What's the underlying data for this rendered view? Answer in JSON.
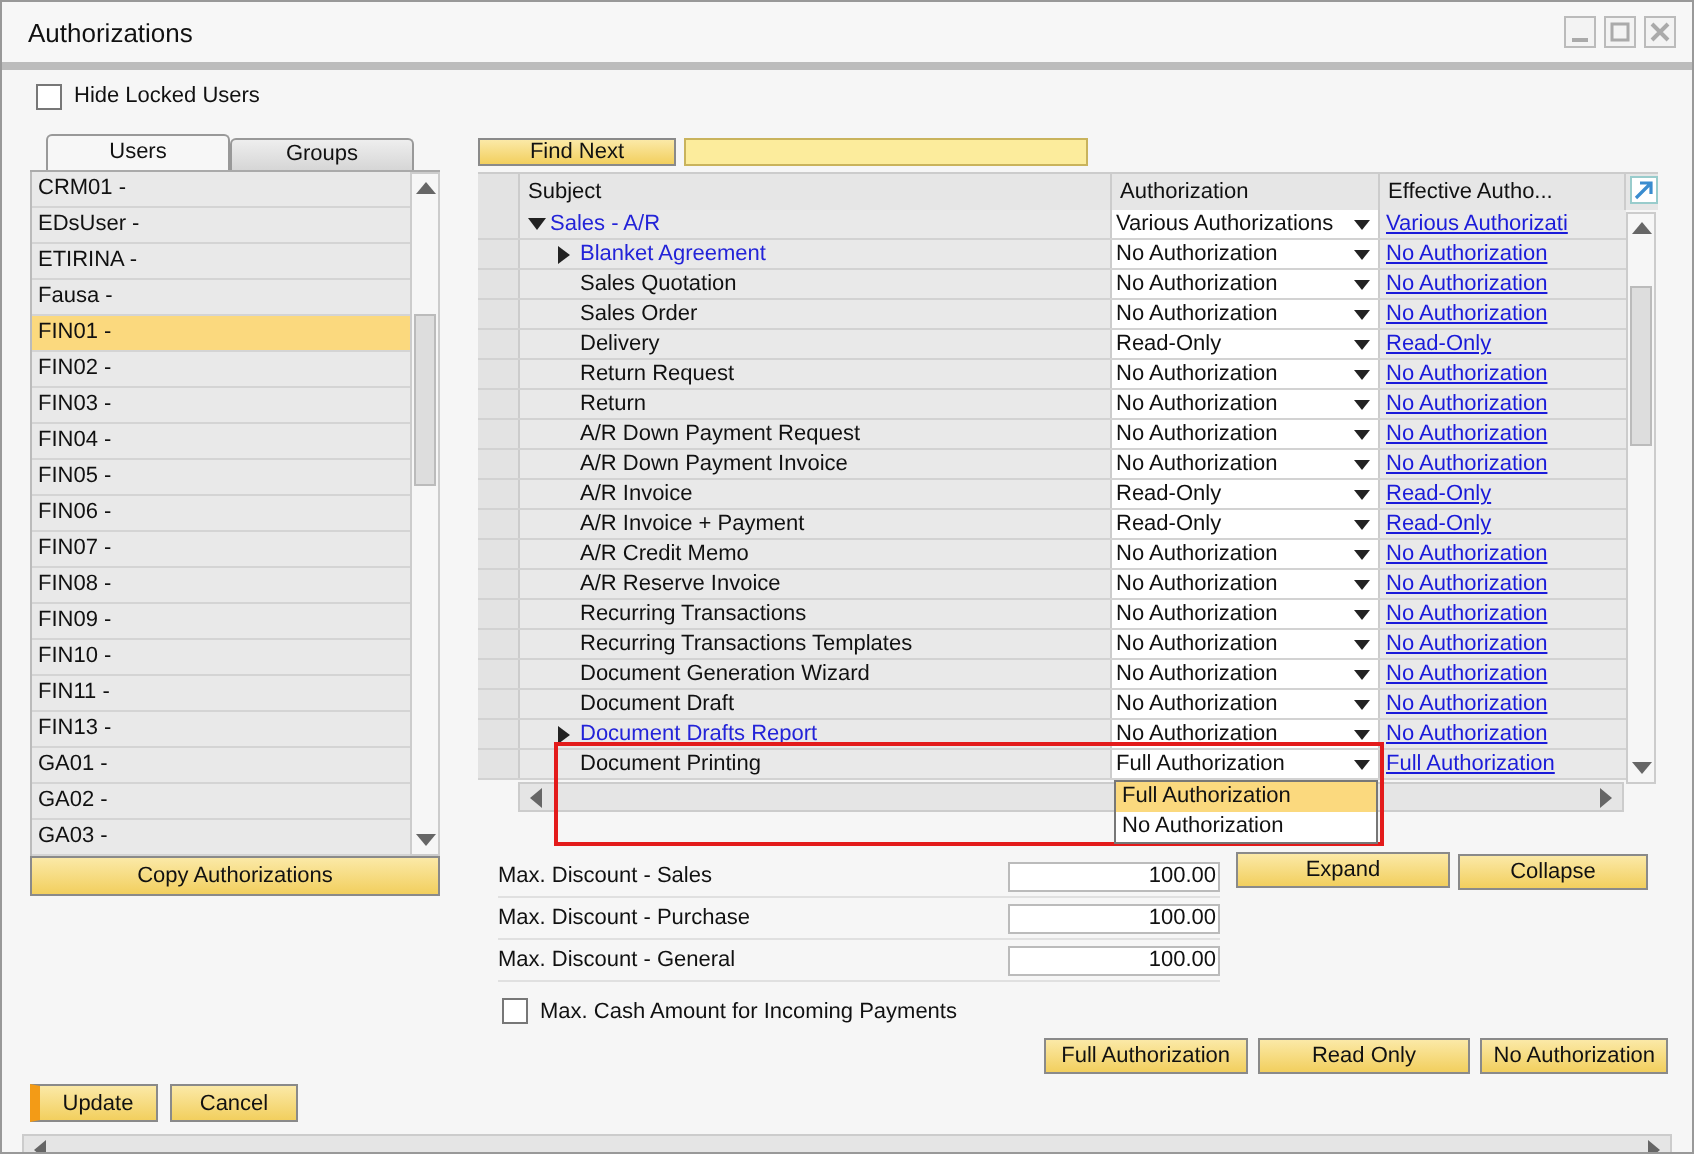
{
  "window": {
    "title": "Authorizations"
  },
  "hide_locked_users": {
    "label": "Hide Locked Users",
    "checked": false
  },
  "user_tabs": [
    {
      "label": "Users",
      "selected": true
    },
    {
      "label": "Groups",
      "selected": false
    }
  ],
  "users": [
    {
      "name": "CRM01 -",
      "selected": false
    },
    {
      "name": "EDsUser -",
      "selected": false
    },
    {
      "name": "ETIRINA -",
      "selected": false
    },
    {
      "name": "Fausa -",
      "selected": false
    },
    {
      "name": "FIN01 -",
      "selected": true
    },
    {
      "name": "FIN02 -",
      "selected": false
    },
    {
      "name": "FIN03 -",
      "selected": false
    },
    {
      "name": "FIN04 -",
      "selected": false
    },
    {
      "name": "FIN05 -",
      "selected": false
    },
    {
      "name": "FIN06 -",
      "selected": false
    },
    {
      "name": "FIN07 -",
      "selected": false
    },
    {
      "name": "FIN08 -",
      "selected": false
    },
    {
      "name": "FIN09 -",
      "selected": false
    },
    {
      "name": "FIN10 -",
      "selected": false
    },
    {
      "name": "FIN11 -",
      "selected": false
    },
    {
      "name": "FIN13 -",
      "selected": false
    },
    {
      "name": "GA01 -",
      "selected": false
    },
    {
      "name": "GA02 -",
      "selected": false
    },
    {
      "name": "GA03 -",
      "selected": false
    }
  ],
  "copy_button": "Copy Authorizations",
  "find_button": "Find Next",
  "grid": {
    "columns": [
      "Subject",
      "Authorization",
      "Effective Autho..."
    ],
    "rows": [
      {
        "subject": "Sales - A/R",
        "kind": "group",
        "expanded": true,
        "authorization": "Various Authorizations",
        "effective": "Various Authorizati",
        "children": [
          {
            "subject": "Blanket Agreement",
            "kind": "group",
            "expanded": false,
            "authorization": "No Authorization",
            "effective": "No Authorization"
          },
          {
            "subject": "Sales Quotation",
            "kind": "item",
            "authorization": "No Authorization",
            "effective": "No Authorization"
          },
          {
            "subject": "Sales Order",
            "kind": "item",
            "authorization": "No Authorization",
            "effective": "No Authorization"
          },
          {
            "subject": "Delivery",
            "kind": "item",
            "authorization": "Read-Only",
            "effective": "Read-Only"
          },
          {
            "subject": "Return Request",
            "kind": "item",
            "authorization": "No Authorization",
            "effective": "No Authorization"
          },
          {
            "subject": "Return",
            "kind": "item",
            "authorization": "No Authorization",
            "effective": "No Authorization"
          },
          {
            "subject": "A/R Down Payment Request",
            "kind": "item",
            "authorization": "No Authorization",
            "effective": "No Authorization"
          },
          {
            "subject": "A/R Down Payment Invoice",
            "kind": "item",
            "authorization": "No Authorization",
            "effective": "No Authorization"
          },
          {
            "subject": "A/R Invoice",
            "kind": "item",
            "authorization": "Read-Only",
            "effective": "Read-Only"
          },
          {
            "subject": "A/R Invoice + Payment",
            "kind": "item",
            "authorization": "Read-Only",
            "effective": "Read-Only"
          },
          {
            "subject": "A/R Credit Memo",
            "kind": "item",
            "authorization": "No Authorization",
            "effective": "No Authorization"
          },
          {
            "subject": "A/R Reserve Invoice",
            "kind": "item",
            "authorization": "No Authorization",
            "effective": "No Authorization"
          },
          {
            "subject": "Recurring Transactions",
            "kind": "item",
            "authorization": "No Authorization",
            "effective": "No Authorization"
          },
          {
            "subject": "Recurring Transactions Templates",
            "kind": "item",
            "authorization": "No Authorization",
            "effective": "No Authorization"
          },
          {
            "subject": "Document Generation Wizard",
            "kind": "item",
            "authorization": "No Authorization",
            "effective": "No Authorization"
          },
          {
            "subject": "Document Draft",
            "kind": "item",
            "authorization": "No Authorization",
            "effective": "No Authorization"
          },
          {
            "subject": "Document Drafts Report",
            "kind": "group",
            "expanded": false,
            "authorization": "No Authorization",
            "effective": "No Authorization"
          },
          {
            "subject": "Document Printing",
            "kind": "item",
            "highlighted": true,
            "authorization": "Full Authorization",
            "effective": "Full Authorization",
            "options": [
              {
                "label": "Full Authorization",
                "selected": true
              },
              {
                "label": "No Authorization",
                "selected": false
              }
            ]
          }
        ]
      }
    ]
  },
  "discounts": [
    {
      "label": "Max. Discount - Sales",
      "value": "100.00"
    },
    {
      "label": "Max. Discount - Purchase",
      "value": "100.00"
    },
    {
      "label": "Max. Discount - General",
      "value": "100.00"
    }
  ],
  "grid_buttons": [
    "Expand",
    "Collapse"
  ],
  "cash_limit": {
    "label": "Max. Cash Amount for Incoming Payments",
    "checked": false
  },
  "set_buttons": [
    "Full Authorization",
    "Read Only",
    "No Authorization"
  ],
  "footer_buttons": [
    "Update",
    "Cancel"
  ]
}
